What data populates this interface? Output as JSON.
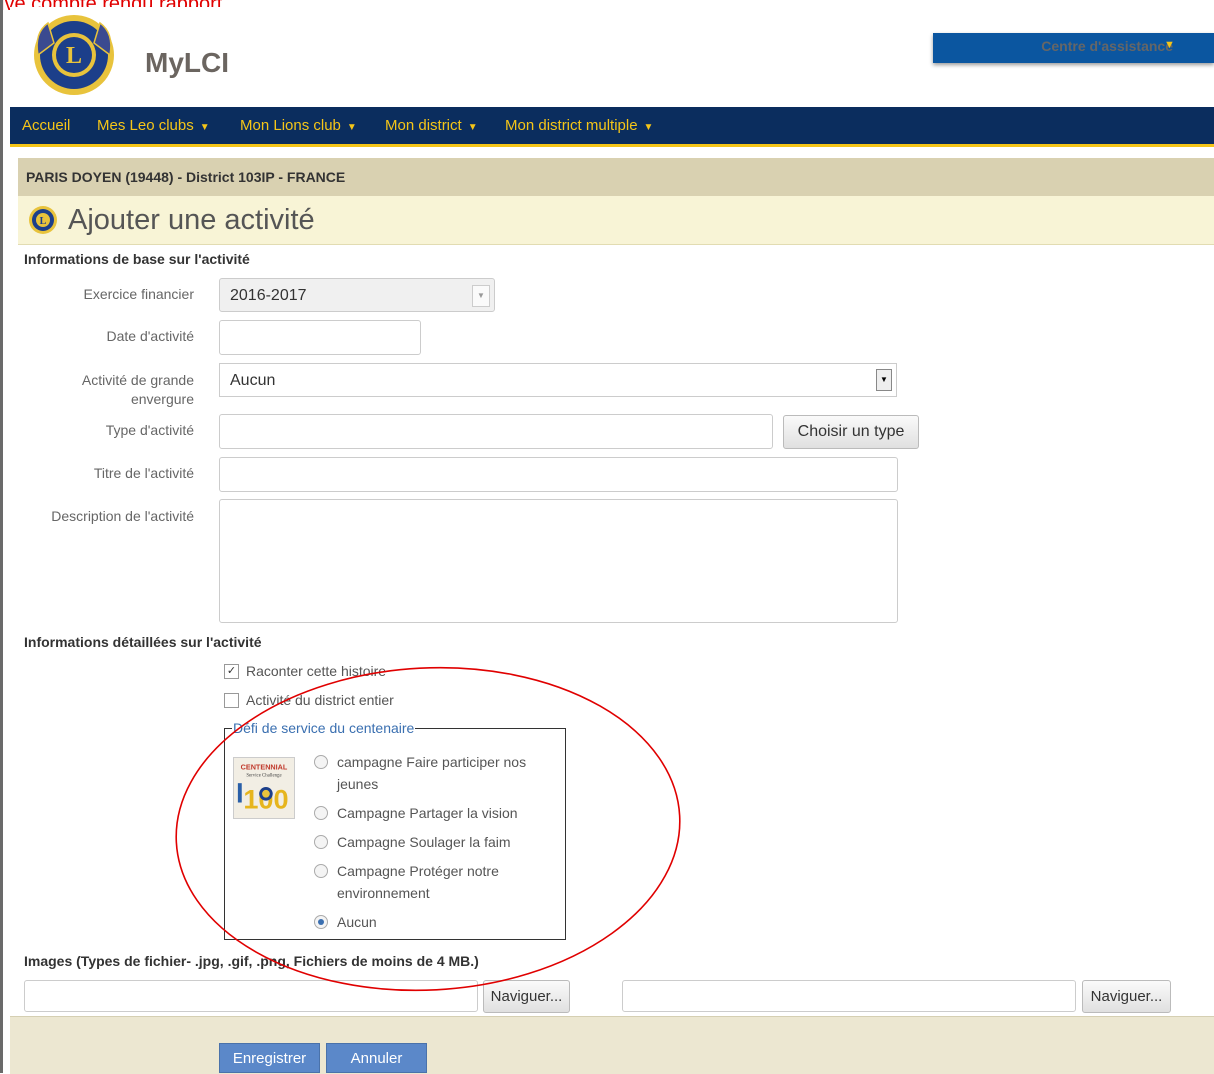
{
  "top_text": "ive compte rendu rapport",
  "header": {
    "brand": "MyLCI",
    "assist_label": "Centre d'assistance"
  },
  "nav": [
    {
      "label": "Accueil",
      "dropdown": false
    },
    {
      "label": "Mes Leo clubs",
      "dropdown": true
    },
    {
      "label": "Mon Lions club",
      "dropdown": true
    },
    {
      "label": "Mon district",
      "dropdown": true
    },
    {
      "label": "Mon district multiple",
      "dropdown": true
    }
  ],
  "breadcrumb": "PARIS DOYEN (19448) - District 103IP - FRANCE",
  "page_title": "Ajouter une activité",
  "basic": {
    "heading": "Informations de base sur l'activité",
    "fiscal_label": "Exercice financier",
    "fiscal_value": "2016-2017",
    "date_label": "Date d'activité",
    "date_value": "",
    "large_label": "Activité de grande envergure",
    "large_value": "Aucun",
    "type_label": "Type d'activité",
    "type_value": "",
    "choose_type": "Choisir un type",
    "title_label": "Titre de l'activité",
    "title_value": "",
    "desc_label": "Description de l'activité",
    "desc_value": ""
  },
  "detailed": {
    "heading": "Informations détaillées sur l'activité",
    "tell_story": "Raconter cette histoire",
    "tell_story_checked": true,
    "district_wide": "Activité du district entier",
    "district_wide_checked": false,
    "centennial_legend": "Défi de service du centenaire",
    "badge": {
      "word": "CENTENNIAL",
      "sub": "Service Challenge",
      "num": "100"
    },
    "options": [
      "campagne Faire participer nos jeunes",
      "Campagne Partager la vision",
      "Campagne Soulager la faim",
      "Campagne Protéger notre environnement",
      "Aucun"
    ],
    "selected": "Aucun"
  },
  "images": {
    "heading": "Images (Types de fichier- .jpg, .gif, .png, Fichiers de moins de 4 MB.)",
    "browse": "Naviguer..."
  },
  "footer": {
    "save": "Enregistrer",
    "cancel": "Annuler"
  },
  "colors": {
    "nav_bg": "#0b2d5e",
    "accent_yellow": "#f5c518",
    "assist_bg": "#0b56a0",
    "annotation_red": "#e00000",
    "button_blue": "#5b88c9"
  }
}
